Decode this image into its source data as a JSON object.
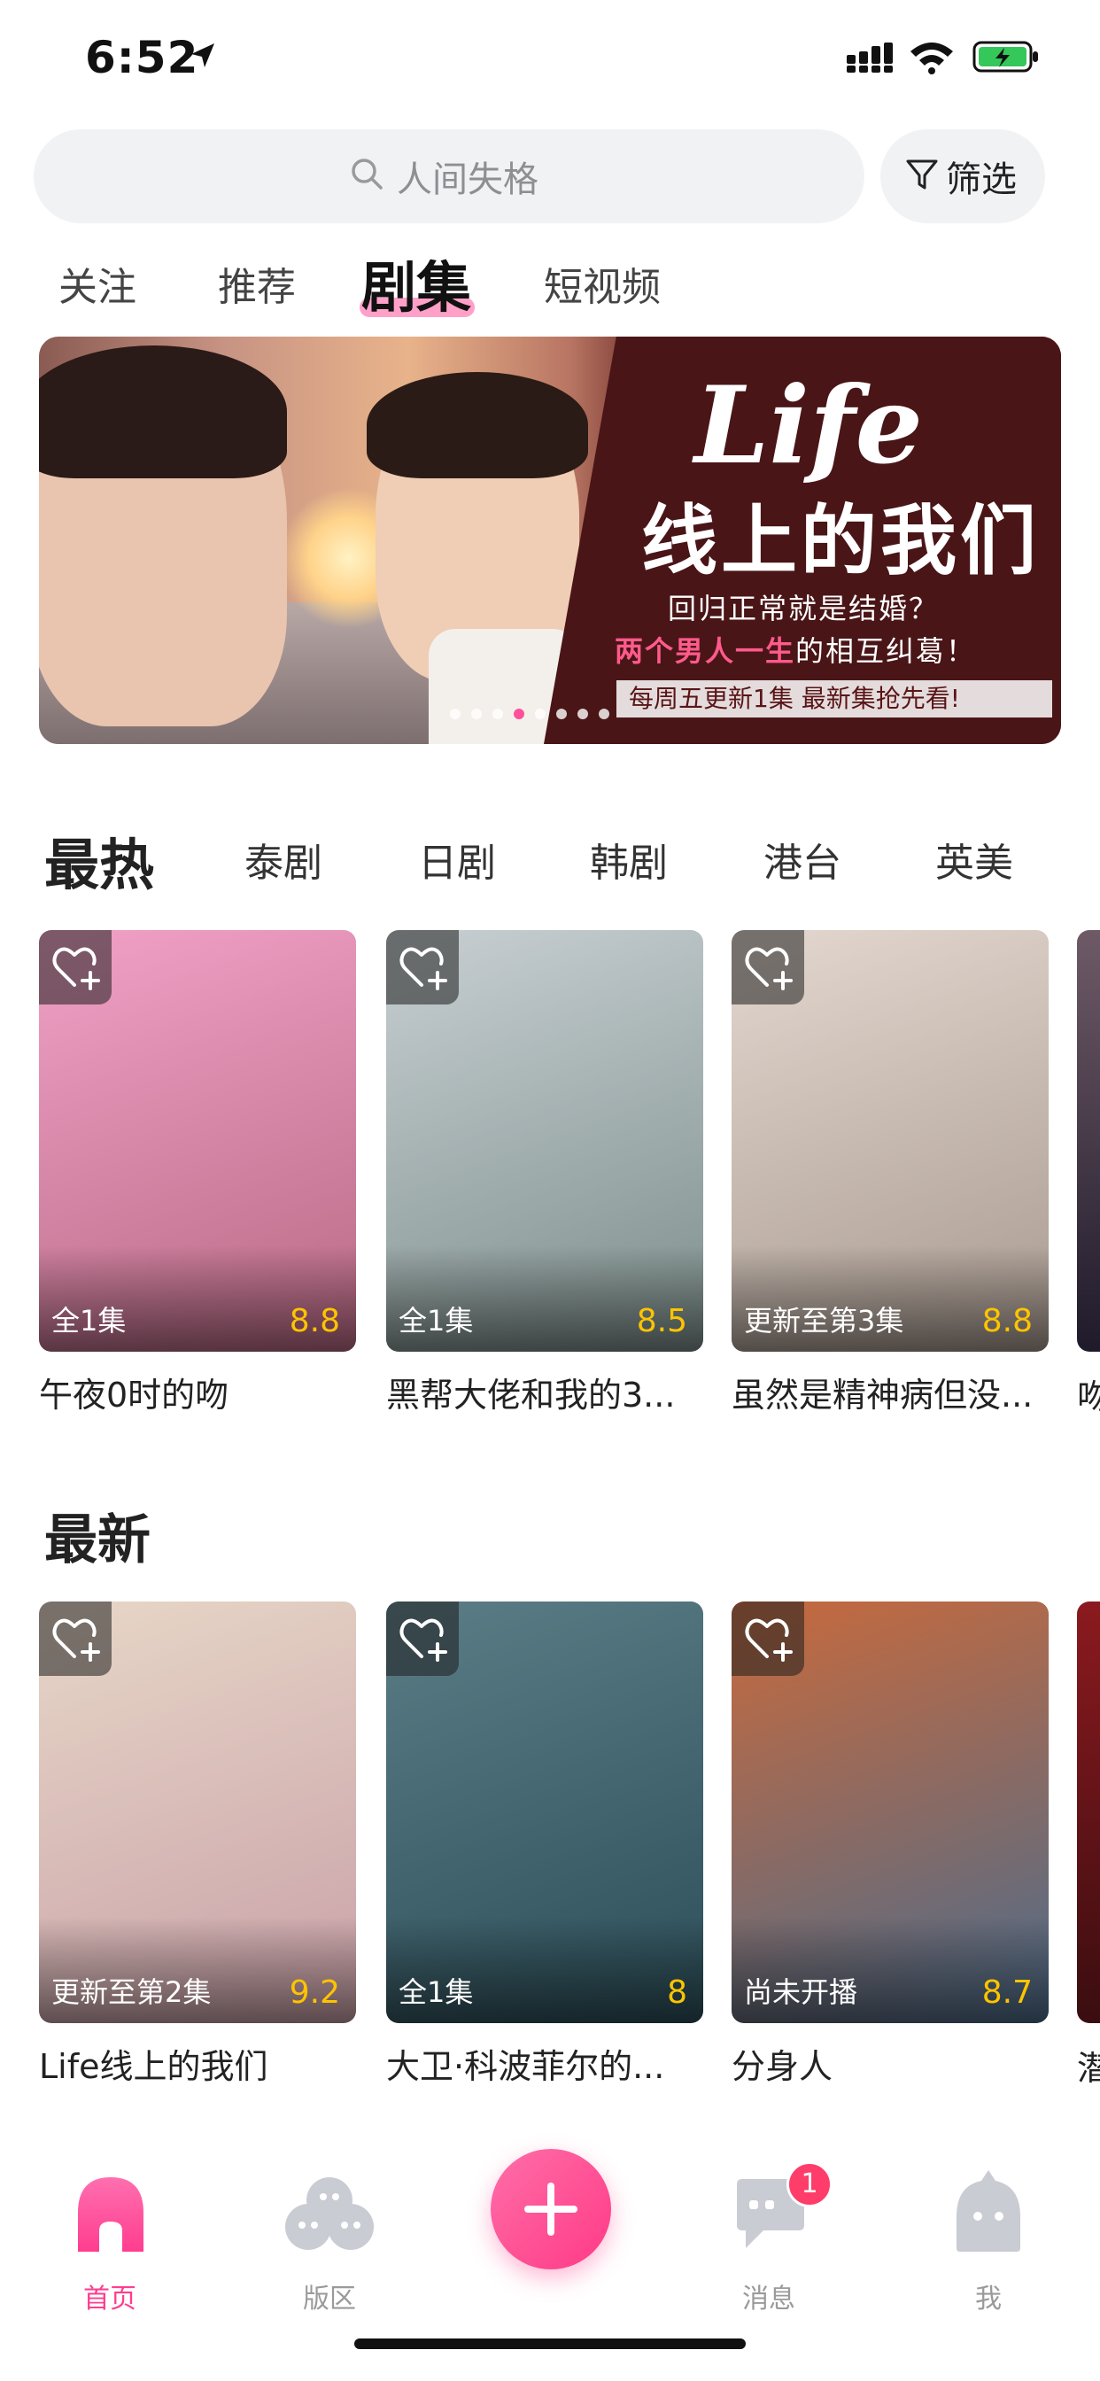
{
  "status": {
    "time": "6:52"
  },
  "search": {
    "placeholder": "人间失格",
    "filter_label": "筛选"
  },
  "tabs": [
    {
      "label": "关注"
    },
    {
      "label": "推荐"
    },
    {
      "label": "剧集",
      "active": true
    },
    {
      "label": "短视频"
    }
  ],
  "banner": {
    "title": "Life",
    "subtitle": "线上的我们",
    "line1": "回归正常就是结婚？",
    "line2_highlight": "两个男人一生",
    "line2_rest": "的相互纠葛！",
    "line3": "每周五更新1集  最新集抢先看!",
    "dot_count": 8,
    "active_dot": 3
  },
  "categories": [
    {
      "label": "最热",
      "active": true
    },
    {
      "label": "泰剧"
    },
    {
      "label": "日剧"
    },
    {
      "label": "韩剧"
    },
    {
      "label": "港台"
    },
    {
      "label": "英美"
    }
  ],
  "hot": {
    "cards": [
      {
        "title": "午夜0时的吻",
        "episodes": "全1集",
        "score": "8.8",
        "colors": [
          "#b86a84",
          "#f1a1c7"
        ]
      },
      {
        "title": "黑帮大佬和我的3...",
        "episodes": "全1集",
        "score": "8.5",
        "colors": [
          "#7d8f8c",
          "#c8cfd2"
        ]
      },
      {
        "title": "虽然是精神病但没...",
        "episodes": "更新至第3集",
        "score": "8.8",
        "colors": [
          "#a89a90",
          "#e3d7cf"
        ]
      }
    ],
    "peek_title": "吻"
  },
  "latest": {
    "title": "最新",
    "cards": [
      {
        "title": "Life线上的我们",
        "episodes": "更新至第2集",
        "score": "9.2",
        "colors": [
          "#c9a0a8",
          "#e7d7c7"
        ]
      },
      {
        "title": "大卫·科波菲尔的...",
        "episodes": "全1集",
        "score": "8",
        "colors": [
          "#2c4e59",
          "#5b7d86"
        ]
      },
      {
        "title": "分身人",
        "episodes": "尚未开播",
        "score": "8.7",
        "colors": [
          "#4c6c8b",
          "#c8693c"
        ]
      }
    ],
    "peek_title": "潜"
  },
  "nav": {
    "items": [
      {
        "label": "首页",
        "active": true
      },
      {
        "label": "版区"
      },
      {
        "label": "消息",
        "badge": "1"
      },
      {
        "label": "我"
      }
    ]
  },
  "colors": {
    "accent": "#ff3d8f",
    "score": "#ffc400"
  }
}
